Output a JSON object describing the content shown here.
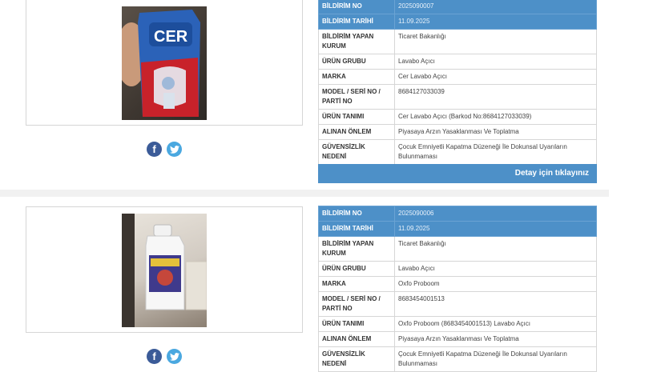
{
  "records": [
    {
      "fields": [
        {
          "label": "BİLDİRİM NO",
          "value": "2025090007",
          "header": true
        },
        {
          "label": "BİLDİRİM TARİHİ",
          "value": "11.09.2025",
          "header": true
        },
        {
          "label": "BİLDİRİM YAPAN KURUM",
          "value": "Ticaret Bakanlığı"
        },
        {
          "label": "ÜRÜN GRUBU",
          "value": "Lavabo Açıcı"
        },
        {
          "label": "MARKA",
          "value": "Cer Lavabo Açıcı"
        },
        {
          "label": "MODEL / SERİ NO / PARTİ NO",
          "value": "8684127033039"
        },
        {
          "label": "ÜRÜN TANIMI",
          "value": "Cer Lavabo Açıcı (Barkod No:8684127033039)"
        },
        {
          "label": "ALINAN ÖNLEM",
          "value": "Piyasaya Arzın Yasaklanması Ve Toplatma"
        },
        {
          "label": "GÜVENSİZLİK NEDENİ",
          "value": "Çocuk Emniyetli Kapatma Düzeneği İle Dokunsal Uyarıların Bulunmaması"
        }
      ],
      "detail_label": "Detay için tıklayınız",
      "product_logo_text": "CER"
    },
    {
      "fields": [
        {
          "label": "BİLDİRİM NO",
          "value": "2025090006",
          "header": true
        },
        {
          "label": "BİLDİRİM TARİHİ",
          "value": "11.09.2025",
          "header": true
        },
        {
          "label": "BİLDİRİM YAPAN KURUM",
          "value": "Ticaret Bakanlığı"
        },
        {
          "label": "ÜRÜN GRUBU",
          "value": "Lavabo Açıcı"
        },
        {
          "label": "MARKA",
          "value": "Oxfo Proboom"
        },
        {
          "label": "MODEL / SERİ NO / PARTİ NO",
          "value": "8683454001513"
        },
        {
          "label": "ÜRÜN TANIMI",
          "value": "Oxfo Proboom (8683454001513) Lavabo Açıcı"
        },
        {
          "label": "ALINAN ÖNLEM",
          "value": "Piyasaya Arzın Yasaklanması Ve Toplatma"
        },
        {
          "label": "GÜVENSİZLİK NEDENİ",
          "value": "Çocuk Emniyetli Kapatma Düzeneği İle Dokunsal Uyarıların Bulunmaması"
        }
      ]
    }
  ],
  "social": {
    "facebook": "f",
    "twitter": "t"
  },
  "colors": {
    "header_blue": "#4d90c8",
    "facebook": "#3b5b98",
    "twitter": "#4aa8e0"
  }
}
